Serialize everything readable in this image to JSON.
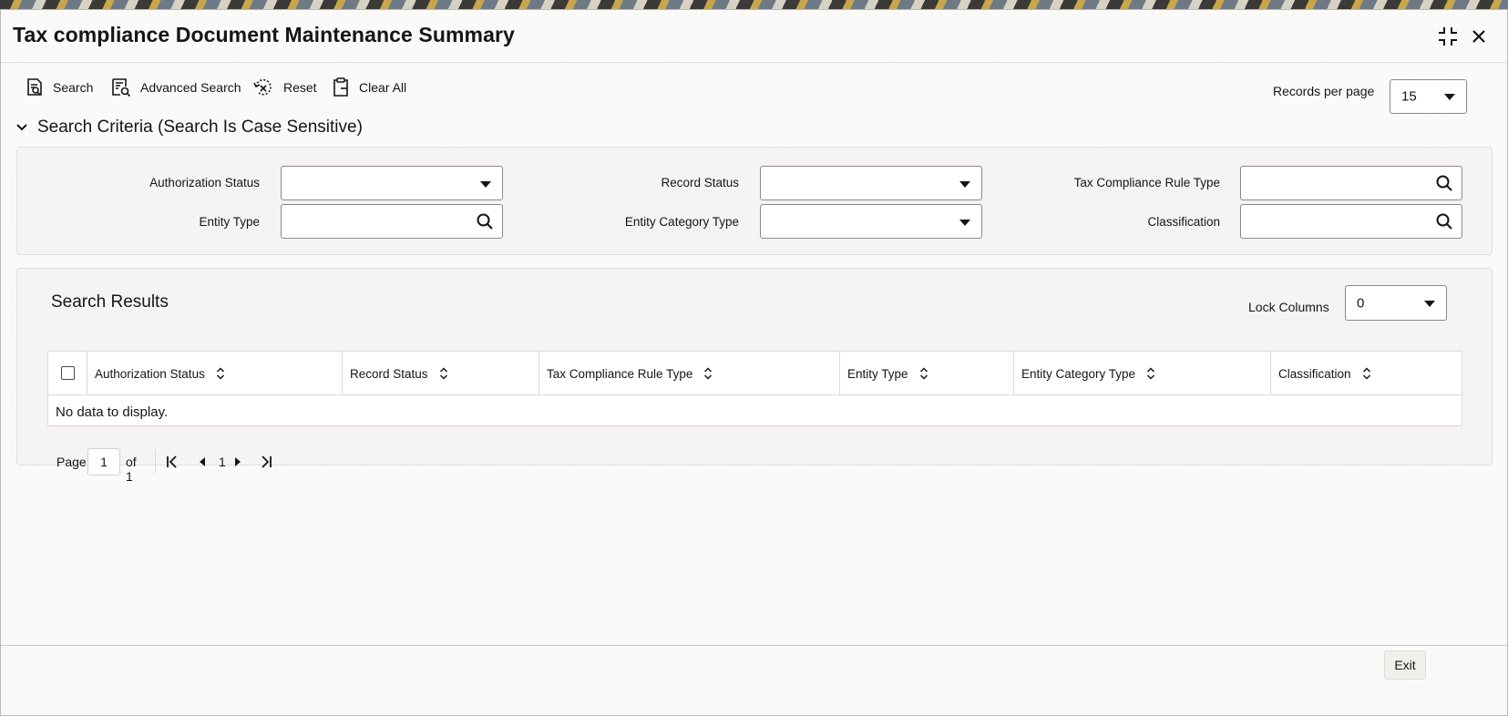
{
  "window": {
    "title": "Tax compliance Document Maintenance Summary"
  },
  "toolbar": {
    "search_label": "Search",
    "advanced_search_label": "Advanced Search",
    "reset_label": "Reset",
    "clear_all_label": "Clear All",
    "records_per_page_label": "Records per page",
    "records_per_page_value": "15"
  },
  "criteria": {
    "header": "Search Criteria (Search Is Case Sensitive)",
    "authorization_status_label": "Authorization Status",
    "record_status_label": "Record Status",
    "tax_rule_type_label": "Tax Compliance Rule Type",
    "entity_type_label": "Entity Type",
    "entity_category_type_label": "Entity Category Type",
    "classification_label": "Classification"
  },
  "results": {
    "title": "Search Results",
    "lock_columns_label": "Lock Columns",
    "lock_columns_value": "0",
    "columns": [
      "Authorization Status",
      "Record Status",
      "Tax Compliance Rule Type",
      "Entity Type",
      "Entity Category Type",
      "Classification"
    ],
    "empty_message": "No data to display."
  },
  "pager": {
    "page_label": "Page",
    "page_value": "1",
    "of_label": "of 1",
    "current_page": "1"
  },
  "footer": {
    "exit_label": "Exit"
  }
}
